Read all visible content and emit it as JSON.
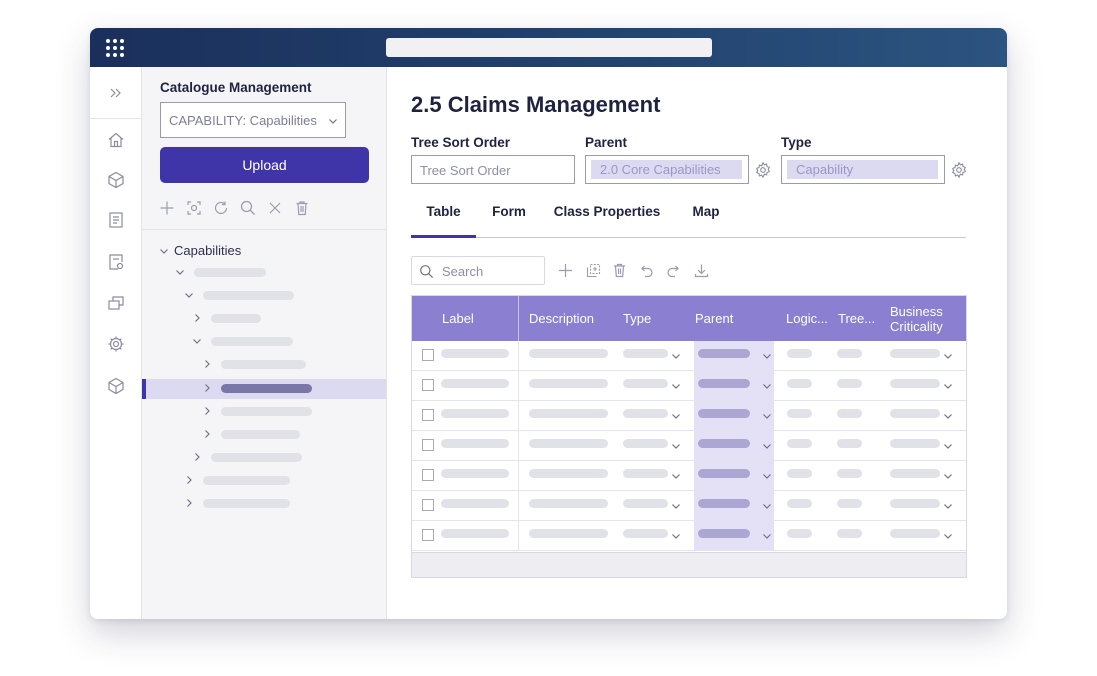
{
  "sidebar": {
    "title": "Catalogue Management",
    "catalogue_select": "CAPABILITY: Capabilities",
    "upload_label": "Upload",
    "tree_root_label": "Capabilities"
  },
  "main": {
    "title": "2.5 Claims Management",
    "fields": {
      "tree_sort_order_label": "Tree Sort Order",
      "tree_sort_order_placeholder": "Tree Sort Order",
      "parent_label": "Parent",
      "parent_value": "2.0 Core Capabilities",
      "type_label": "Type",
      "type_value": "Capability"
    },
    "tabs": [
      {
        "label": "Table"
      },
      {
        "label": "Form"
      },
      {
        "label": "Class Properties"
      },
      {
        "label": "Map"
      }
    ],
    "search_placeholder": "Search",
    "grid": {
      "columns": [
        "Label",
        "Description",
        "Type",
        "Parent",
        "Logic...",
        "Tree...",
        "Business Criticality"
      ]
    }
  },
  "colors": {
    "topbar": "#1b2f5b",
    "accent": "#3f34a8",
    "grid_header": "#8a7fd0",
    "selection": "#dcdaf1"
  },
  "icons": {
    "rail": [
      "expand-icon",
      "home-icon",
      "layers-icon",
      "book-icon",
      "report-icon",
      "windows-icon",
      "settings-icon",
      "cube-icon"
    ],
    "panel_tools": [
      "add-icon",
      "focus-icon",
      "refresh-icon",
      "search-icon",
      "close-icon",
      "delete-icon"
    ],
    "grid_tools": [
      "add-icon",
      "copy-icon",
      "delete-icon",
      "undo-icon",
      "redo-icon",
      "download-icon"
    ]
  }
}
